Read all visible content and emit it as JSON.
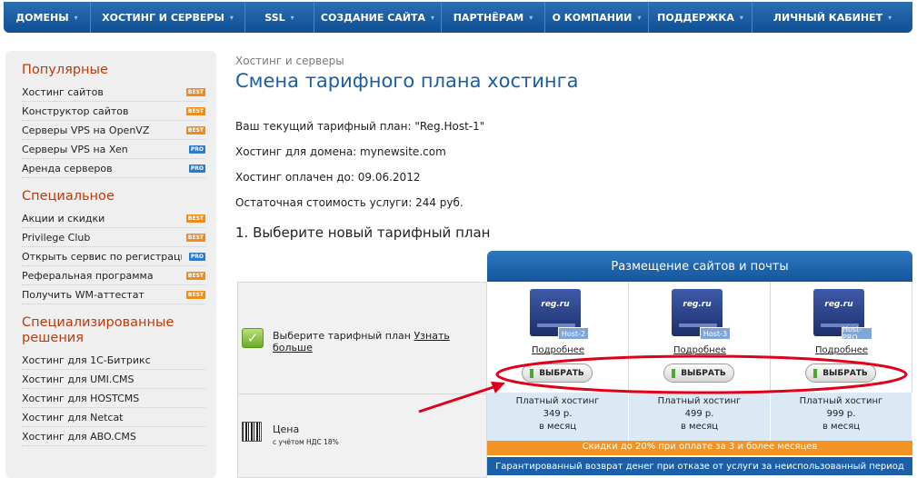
{
  "nav": {
    "items": [
      {
        "label": "ДОМЕНЫ",
        "width": 96
      },
      {
        "label": "ХОСТИНГ И СЕРВЕРЫ",
        "width": 170
      },
      {
        "label": "SSL",
        "width": 76
      },
      {
        "label": "СОЗДАНИЕ САЙТА",
        "width": 140
      },
      {
        "label": "ПАРТНЁРАМ",
        "width": 114
      },
      {
        "label": "О КОМПАНИИ",
        "width": 114
      },
      {
        "label": "ПОДДЕРЖКА",
        "width": 114
      },
      {
        "label": "ЛИЧНЫЙ КАБИНЕТ",
        "width": 176
      }
    ]
  },
  "sidebar": {
    "groups": [
      {
        "title": "Популярные",
        "items": [
          {
            "label": "Хостинг сайтов",
            "badge": "BEST"
          },
          {
            "label": "Конструктор сайтов",
            "badge": "BEST"
          },
          {
            "label": "Серверы VPS на OpenVZ",
            "badge": "BEST"
          },
          {
            "label": "Серверы VPS на Xen",
            "badge": "PRO"
          },
          {
            "label": "Аренда серверов",
            "badge": "PRO"
          }
        ]
      },
      {
        "title": "Специальное",
        "items": [
          {
            "label": "Акции и скидки",
            "badge": "BEST"
          },
          {
            "label": "Privilege Club",
            "badge": "BEST"
          },
          {
            "label": "Открыть сервис по регистрации",
            "badge": "PRO"
          },
          {
            "label": "Реферальная программа",
            "badge": "BEST"
          },
          {
            "label": "Получить WM-аттестат",
            "badge": "BEST"
          }
        ]
      },
      {
        "title": "Специализированные решения",
        "items": [
          {
            "label": "Хостинг для 1С-Битрикс",
            "badge": ""
          },
          {
            "label": "Хостинг для UMI.CMS",
            "badge": ""
          },
          {
            "label": "Хостинг для HOSTCMS",
            "badge": ""
          },
          {
            "label": "Хостинг для Netcat",
            "badge": ""
          },
          {
            "label": "Хостинг для ABO.CMS",
            "badge": ""
          }
        ]
      }
    ]
  },
  "main": {
    "breadcrumb": "Хостинг и серверы",
    "title": "Смена тарифного плана хостинга",
    "info": [
      "Ваш текущий тарифный план: \"Reg.Host-1\"",
      "Хостинг для домена: mynewsite.com",
      "Хостинг оплачен до: 09.06.2012",
      "Остаточная стоимость услуги: 244 руб."
    ],
    "step": "1. Выберите новый тарифный план"
  },
  "plans": {
    "header": "Размещение сайтов и почты",
    "choose_label": "Выберите тарифный план",
    "learn_more": "Узнать больше",
    "price_label": "Цена",
    "price_sub": "с учётом НДС 18%",
    "items": [
      {
        "tag": "Host-2",
        "logo": "reg.ru",
        "more": "Подробнее",
        "button": "ВЫБРАТЬ",
        "kind": "Платный хостинг",
        "price": "349 р.",
        "period": "в месяц"
      },
      {
        "tag": "Host-3",
        "logo": "reg.ru",
        "more": "Подробнее",
        "button": "ВЫБРАТЬ",
        "kind": "Платный хостинг",
        "price": "499 р.",
        "period": "в месяц"
      },
      {
        "tag": "Host-PRO",
        "logo": "reg.ru",
        "more": "Подробнее",
        "button": "ВЫБРАТЬ",
        "kind": "Платный хостинг",
        "price": "999 р.",
        "period": "в месяц"
      }
    ],
    "discount": "Скидки до 20% при оплате за 3 и более месяцев",
    "guarantee": "Гарантированный возврат денег при отказе от услуги за неиспользованный период"
  },
  "colors": {
    "accent": "#1b5ea6",
    "annotation": "#e0001a",
    "orange": "#f39323"
  }
}
